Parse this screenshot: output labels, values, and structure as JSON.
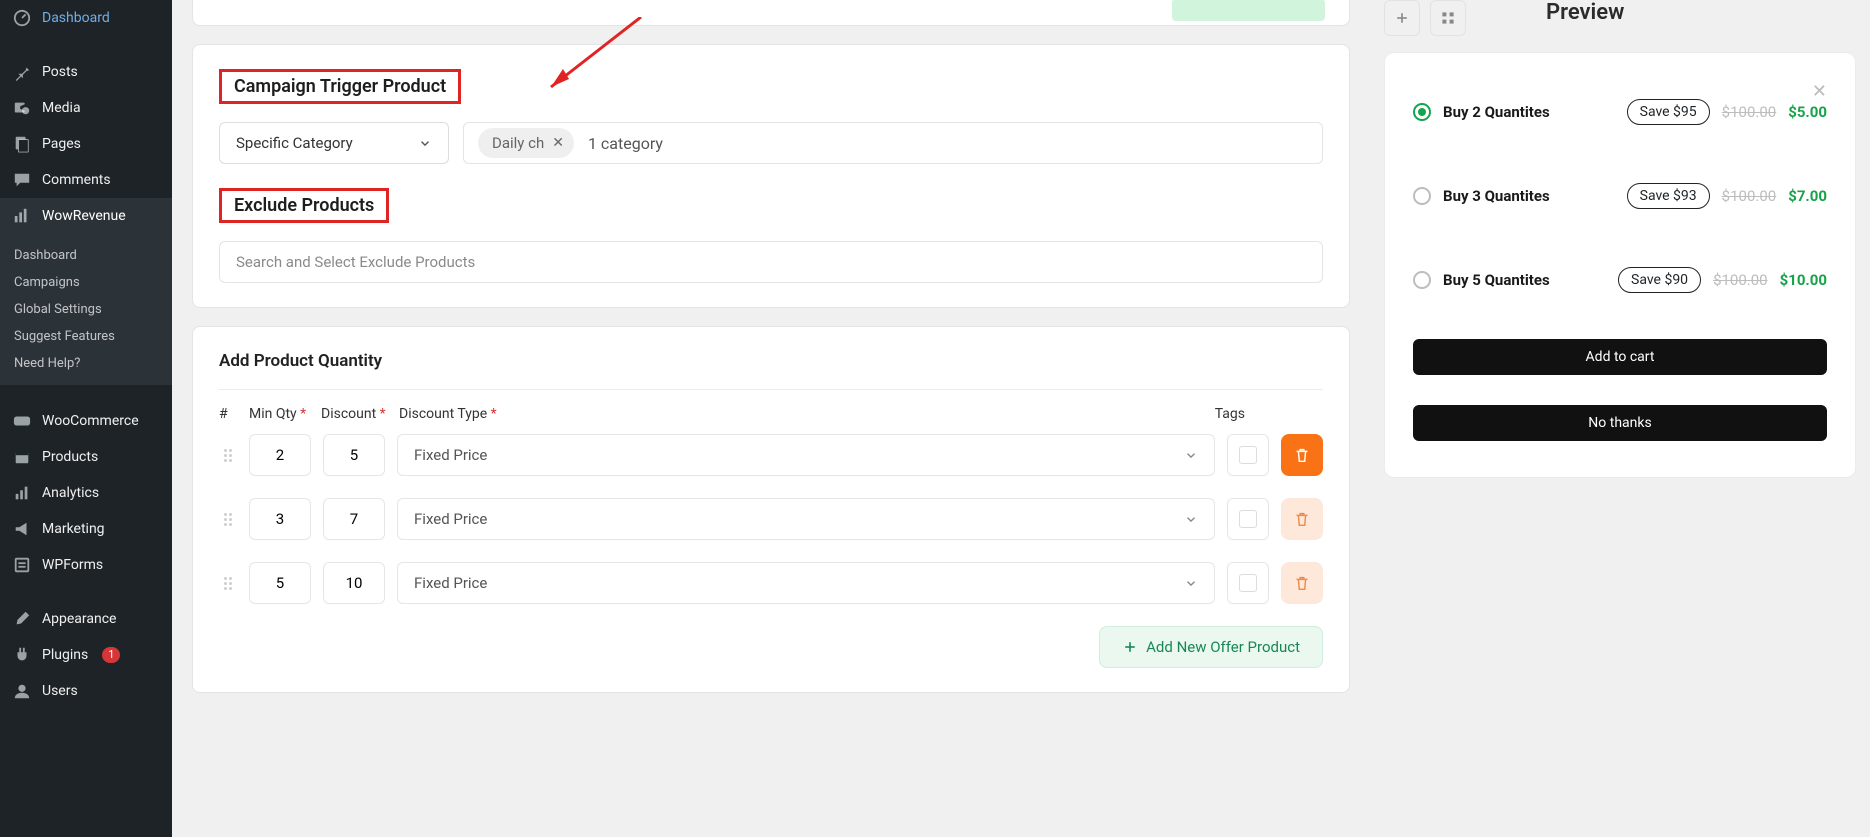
{
  "sidebar": {
    "items": [
      {
        "label": "Dashboard",
        "icon": "dashboard"
      },
      {
        "label": "Posts",
        "icon": "pin"
      },
      {
        "label": "Media",
        "icon": "media"
      },
      {
        "label": "Pages",
        "icon": "pages"
      },
      {
        "label": "Comments",
        "icon": "comments"
      },
      {
        "label": "WowRevenue",
        "icon": "chart",
        "active": true
      },
      {
        "label": "WooCommerce",
        "icon": "woo"
      },
      {
        "label": "Products",
        "icon": "box"
      },
      {
        "label": "Analytics",
        "icon": "analytics"
      },
      {
        "label": "Marketing",
        "icon": "megaphone"
      },
      {
        "label": "WPForms",
        "icon": "wpforms"
      },
      {
        "label": "Appearance",
        "icon": "brush"
      },
      {
        "label": "Plugins",
        "icon": "plug",
        "badge": "1"
      },
      {
        "label": "Users",
        "icon": "users"
      }
    ],
    "sub": [
      "Dashboard",
      "Campaigns",
      "Global Settings",
      "Suggest Features",
      "Need Help?"
    ]
  },
  "campaign": {
    "trigger_title": "Campaign Trigger Product",
    "trigger_select": "Specific Category",
    "chip": "Daily ch",
    "chip_summary": "1 category",
    "exclude_title": "Exclude Products",
    "exclude_placeholder": "Search and Select Exclude Products"
  },
  "quantity": {
    "title": "Add Product Quantity",
    "headers": {
      "hash": "#",
      "min": "Min Qty",
      "disc": "Discount",
      "dtype": "Discount Type",
      "tags": "Tags",
      "req": "*"
    },
    "rows": [
      {
        "min": "2",
        "disc": "5",
        "type": "Fixed Price"
      },
      {
        "min": "3",
        "disc": "7",
        "type": "Fixed Price"
      },
      {
        "min": "5",
        "disc": "10",
        "type": "Fixed Price"
      }
    ],
    "add_btn": "Add New Offer Product"
  },
  "preview": {
    "title": "Preview",
    "offers": [
      {
        "label": "Buy 2 Quantites",
        "save": "Save $95",
        "old": "$100.00",
        "price": "$5.00",
        "checked": true
      },
      {
        "label": "Buy 3 Quantites",
        "save": "Save $93",
        "old": "$100.00",
        "price": "$7.00",
        "checked": false
      },
      {
        "label": "Buy 5 Quantites",
        "save": "Save $90",
        "old": "$100.00",
        "price": "$10.00",
        "checked": false
      }
    ],
    "add_to_cart": "Add to cart",
    "no_thanks": "No thanks"
  }
}
